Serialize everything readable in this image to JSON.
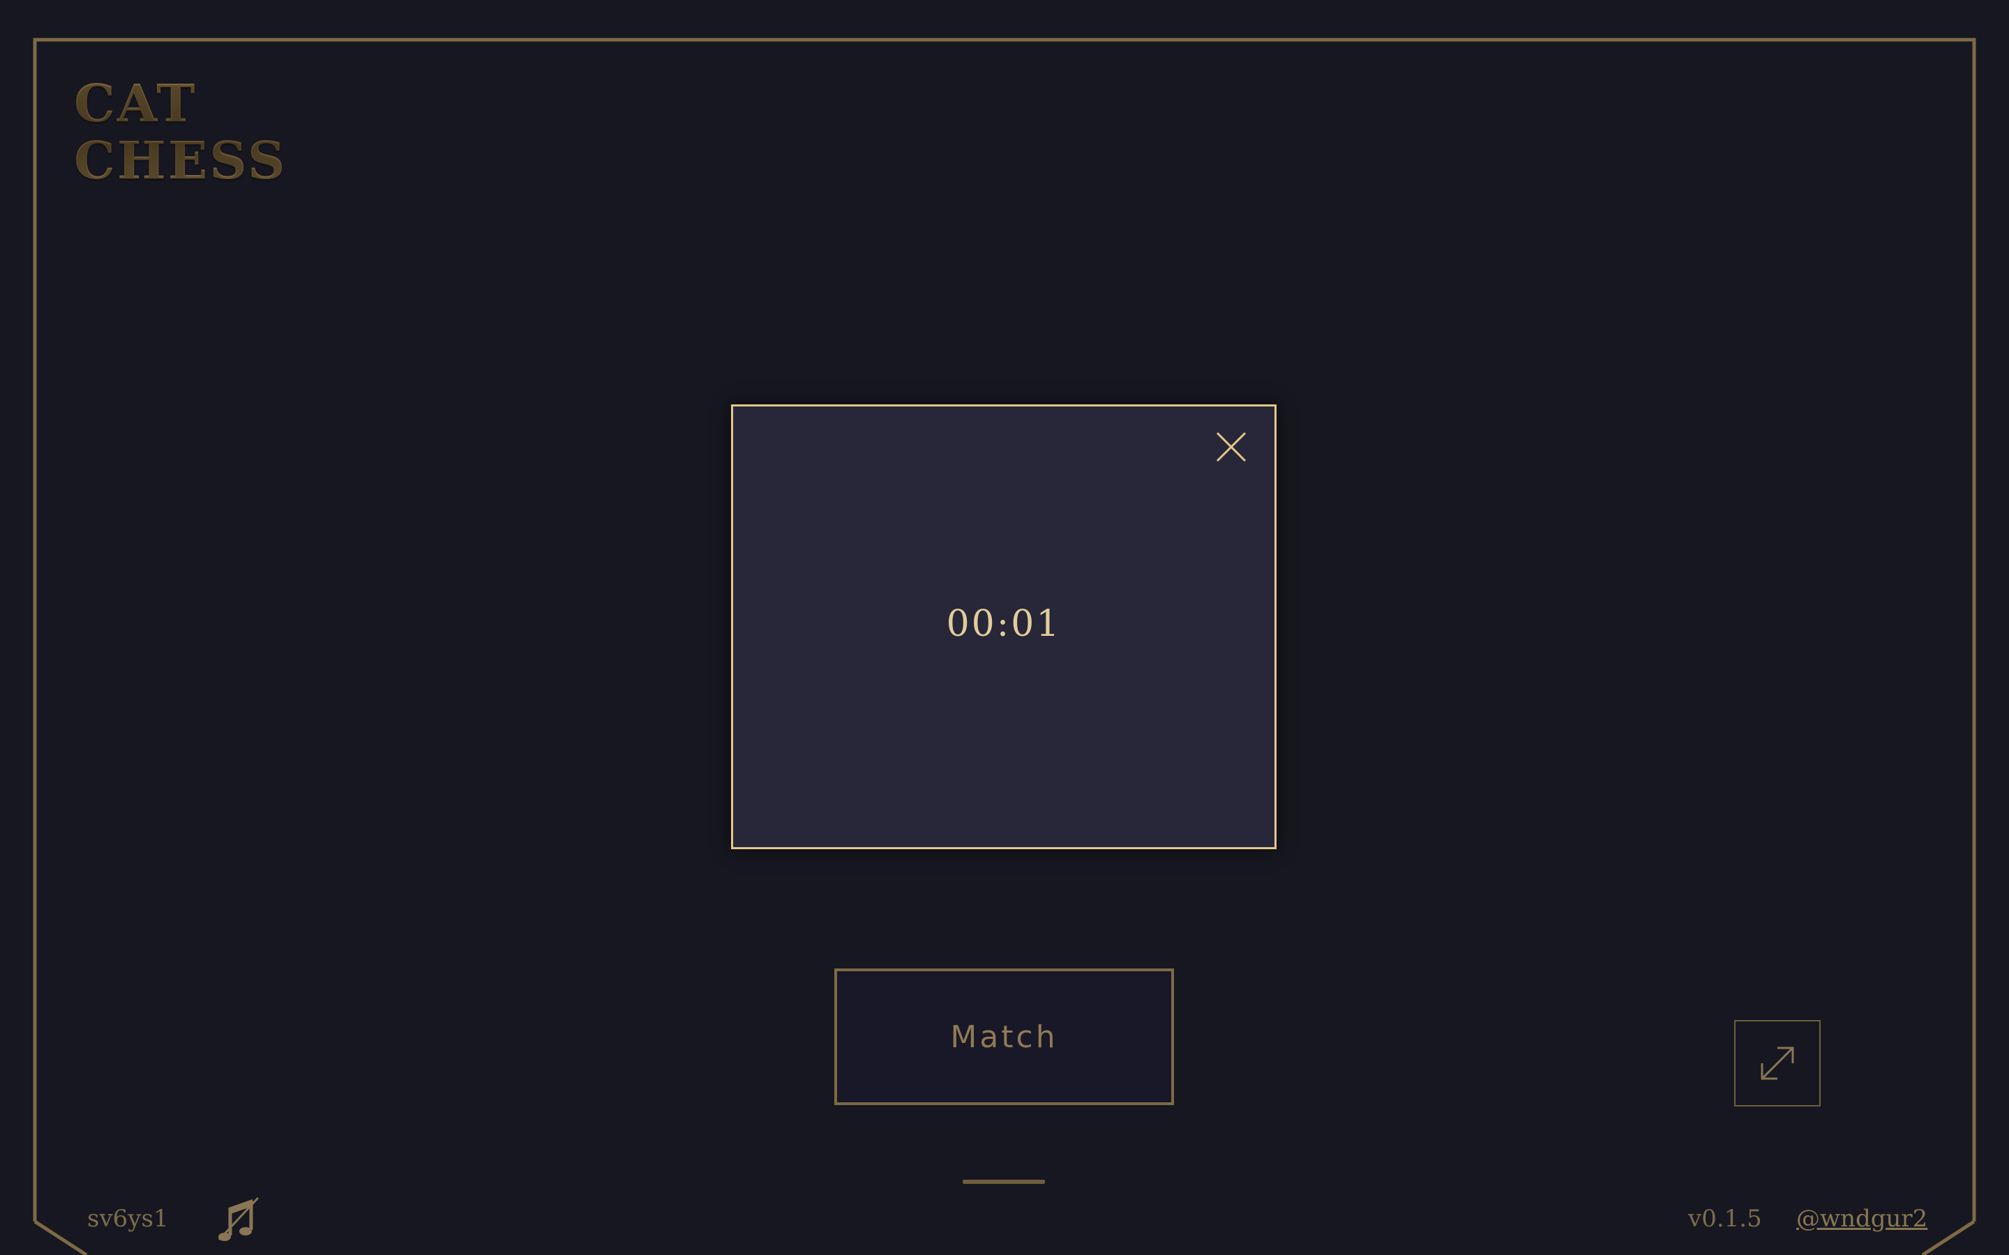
{
  "logo": {
    "line1": "CAT",
    "line2": "CHESS"
  },
  "modal": {
    "timer": "00:01",
    "close_icon": "close-icon"
  },
  "actions": {
    "match_label": "Match",
    "fullscreen_icon": "expand-diagonal-icon"
  },
  "footer": {
    "server_code": "sv6ys1",
    "music_icon": "music-note-icon",
    "version": "v0.1.5",
    "user_link": "@wndgur2"
  },
  "colors": {
    "background": "#161720",
    "frame_gold": "#7d6a45",
    "modal_bg": "#272739",
    "modal_border": "#e2c888",
    "text_gold": "#e2cd9a",
    "button_bg": "#181828"
  }
}
